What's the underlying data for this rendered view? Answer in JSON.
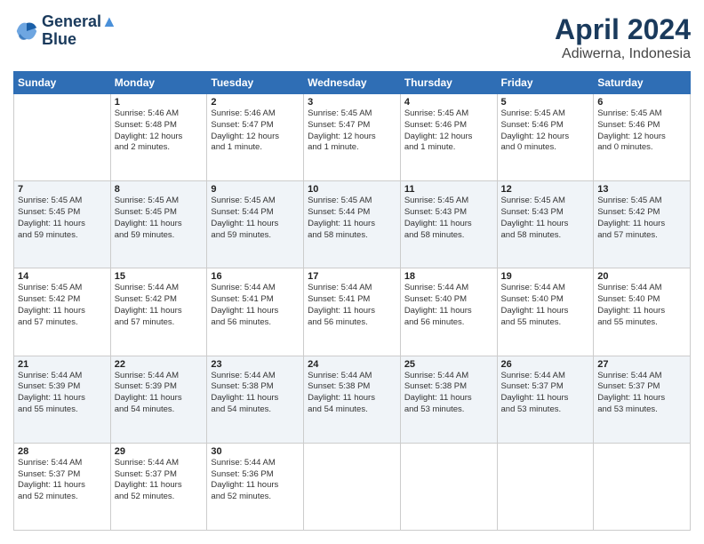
{
  "header": {
    "logo_line1": "General",
    "logo_line2": "Blue",
    "main_title": "April 2024",
    "subtitle": "Adiwerna, Indonesia"
  },
  "days_of_week": [
    "Sunday",
    "Monday",
    "Tuesday",
    "Wednesday",
    "Thursday",
    "Friday",
    "Saturday"
  ],
  "weeks": [
    [
      {
        "day": "",
        "text": ""
      },
      {
        "day": "1",
        "text": "Sunrise: 5:46 AM\nSunset: 5:48 PM\nDaylight: 12 hours\nand 2 minutes."
      },
      {
        "day": "2",
        "text": "Sunrise: 5:46 AM\nSunset: 5:47 PM\nDaylight: 12 hours\nand 1 minute."
      },
      {
        "day": "3",
        "text": "Sunrise: 5:45 AM\nSunset: 5:47 PM\nDaylight: 12 hours\nand 1 minute."
      },
      {
        "day": "4",
        "text": "Sunrise: 5:45 AM\nSunset: 5:46 PM\nDaylight: 12 hours\nand 1 minute."
      },
      {
        "day": "5",
        "text": "Sunrise: 5:45 AM\nSunset: 5:46 PM\nDaylight: 12 hours\nand 0 minutes."
      },
      {
        "day": "6",
        "text": "Sunrise: 5:45 AM\nSunset: 5:46 PM\nDaylight: 12 hours\nand 0 minutes."
      }
    ],
    [
      {
        "day": "7",
        "text": "Sunrise: 5:45 AM\nSunset: 5:45 PM\nDaylight: 11 hours\nand 59 minutes."
      },
      {
        "day": "8",
        "text": "Sunrise: 5:45 AM\nSunset: 5:45 PM\nDaylight: 11 hours\nand 59 minutes."
      },
      {
        "day": "9",
        "text": "Sunrise: 5:45 AM\nSunset: 5:44 PM\nDaylight: 11 hours\nand 59 minutes."
      },
      {
        "day": "10",
        "text": "Sunrise: 5:45 AM\nSunset: 5:44 PM\nDaylight: 11 hours\nand 58 minutes."
      },
      {
        "day": "11",
        "text": "Sunrise: 5:45 AM\nSunset: 5:43 PM\nDaylight: 11 hours\nand 58 minutes."
      },
      {
        "day": "12",
        "text": "Sunrise: 5:45 AM\nSunset: 5:43 PM\nDaylight: 11 hours\nand 58 minutes."
      },
      {
        "day": "13",
        "text": "Sunrise: 5:45 AM\nSunset: 5:42 PM\nDaylight: 11 hours\nand 57 minutes."
      }
    ],
    [
      {
        "day": "14",
        "text": "Sunrise: 5:45 AM\nSunset: 5:42 PM\nDaylight: 11 hours\nand 57 minutes."
      },
      {
        "day": "15",
        "text": "Sunrise: 5:44 AM\nSunset: 5:42 PM\nDaylight: 11 hours\nand 57 minutes."
      },
      {
        "day": "16",
        "text": "Sunrise: 5:44 AM\nSunset: 5:41 PM\nDaylight: 11 hours\nand 56 minutes."
      },
      {
        "day": "17",
        "text": "Sunrise: 5:44 AM\nSunset: 5:41 PM\nDaylight: 11 hours\nand 56 minutes."
      },
      {
        "day": "18",
        "text": "Sunrise: 5:44 AM\nSunset: 5:40 PM\nDaylight: 11 hours\nand 56 minutes."
      },
      {
        "day": "19",
        "text": "Sunrise: 5:44 AM\nSunset: 5:40 PM\nDaylight: 11 hours\nand 55 minutes."
      },
      {
        "day": "20",
        "text": "Sunrise: 5:44 AM\nSunset: 5:40 PM\nDaylight: 11 hours\nand 55 minutes."
      }
    ],
    [
      {
        "day": "21",
        "text": "Sunrise: 5:44 AM\nSunset: 5:39 PM\nDaylight: 11 hours\nand 55 minutes."
      },
      {
        "day": "22",
        "text": "Sunrise: 5:44 AM\nSunset: 5:39 PM\nDaylight: 11 hours\nand 54 minutes."
      },
      {
        "day": "23",
        "text": "Sunrise: 5:44 AM\nSunset: 5:38 PM\nDaylight: 11 hours\nand 54 minutes."
      },
      {
        "day": "24",
        "text": "Sunrise: 5:44 AM\nSunset: 5:38 PM\nDaylight: 11 hours\nand 54 minutes."
      },
      {
        "day": "25",
        "text": "Sunrise: 5:44 AM\nSunset: 5:38 PM\nDaylight: 11 hours\nand 53 minutes."
      },
      {
        "day": "26",
        "text": "Sunrise: 5:44 AM\nSunset: 5:37 PM\nDaylight: 11 hours\nand 53 minutes."
      },
      {
        "day": "27",
        "text": "Sunrise: 5:44 AM\nSunset: 5:37 PM\nDaylight: 11 hours\nand 53 minutes."
      }
    ],
    [
      {
        "day": "28",
        "text": "Sunrise: 5:44 AM\nSunset: 5:37 PM\nDaylight: 11 hours\nand 52 minutes."
      },
      {
        "day": "29",
        "text": "Sunrise: 5:44 AM\nSunset: 5:37 PM\nDaylight: 11 hours\nand 52 minutes."
      },
      {
        "day": "30",
        "text": "Sunrise: 5:44 AM\nSunset: 5:36 PM\nDaylight: 11 hours\nand 52 minutes."
      },
      {
        "day": "",
        "text": ""
      },
      {
        "day": "",
        "text": ""
      },
      {
        "day": "",
        "text": ""
      },
      {
        "day": "",
        "text": ""
      }
    ]
  ]
}
